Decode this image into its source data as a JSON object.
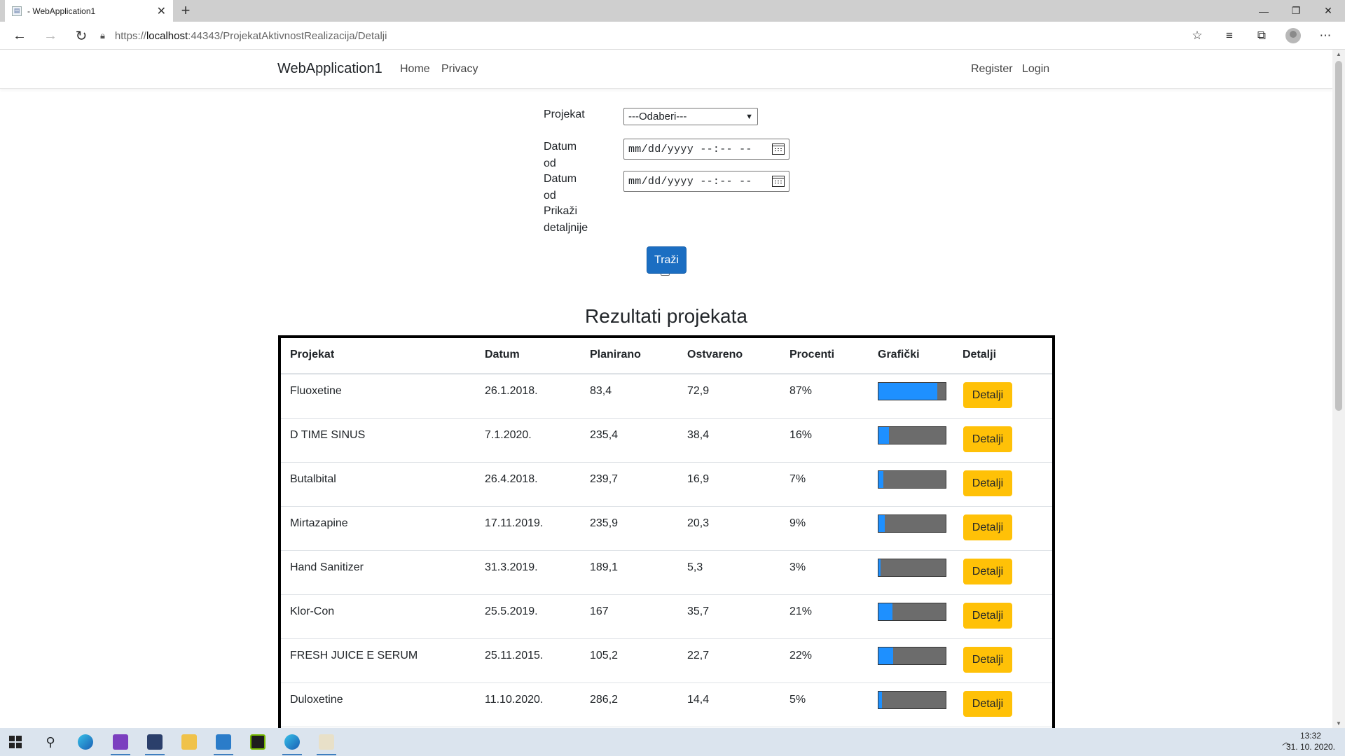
{
  "browser": {
    "tab_title": "- WebApplication1",
    "tab_close": "✕",
    "new_tab": "+",
    "url_prefix": "https://",
    "url_host": "localhost",
    "url_rest": ":44343/ProjekatAktivnostRealizacija/Detalji",
    "window_controls": [
      "—",
      "❐",
      "✕"
    ]
  },
  "navbar": {
    "brand": "WebApplication1",
    "links": [
      "Home",
      "Privacy"
    ],
    "right_links": [
      "Register",
      "Login"
    ]
  },
  "form": {
    "projekat_label": "Projekat",
    "projekat_selected": "---Odaberi---",
    "datum_od_label_1": "Datum od",
    "datum_od_value_1": "mm/dd/yyyy --:-- --",
    "datum_od_label_2": "Datum od",
    "datum_od_value_2": "mm/dd/yyyy --:-- --",
    "prikazi_label_line1": "Prikaži",
    "prikazi_label_line2": "detaljnije",
    "search_button": "Traži"
  },
  "results": {
    "heading": "Rezultati projekata",
    "columns": [
      "Projekat",
      "Datum",
      "Planirano",
      "Ostvareno",
      "Procenti",
      "Grafički",
      "Detalji"
    ],
    "details_button": "Detalji",
    "rows": [
      {
        "projekat": "Fluoxetine",
        "datum": "26.1.2018.",
        "planirano": "83,4",
        "ostvareno": "72,9",
        "procenti": "87%",
        "fraction": 0.87
      },
      {
        "projekat": "D TIME SINUS",
        "datum": "7.1.2020.",
        "planirano": "235,4",
        "ostvareno": "38,4",
        "procenti": "16%",
        "fraction": 0.16
      },
      {
        "projekat": "Butalbital",
        "datum": "26.4.2018.",
        "planirano": "239,7",
        "ostvareno": "16,9",
        "procenti": "7%",
        "fraction": 0.07
      },
      {
        "projekat": "Mirtazapine",
        "datum": "17.11.2019.",
        "planirano": "235,9",
        "ostvareno": "20,3",
        "procenti": "9%",
        "fraction": 0.09
      },
      {
        "projekat": "Hand Sanitizer",
        "datum": "31.3.2019.",
        "planirano": "189,1",
        "ostvareno": "5,3",
        "procenti": "3%",
        "fraction": 0.03
      },
      {
        "projekat": "Klor-Con",
        "datum": "25.5.2019.",
        "planirano": "167",
        "ostvareno": "35,7",
        "procenti": "21%",
        "fraction": 0.21
      },
      {
        "projekat": "FRESH JUICE E SERUM",
        "datum": "25.11.2015.",
        "planirano": "105,2",
        "ostvareno": "22,7",
        "procenti": "22%",
        "fraction": 0.22
      },
      {
        "projekat": "Duloxetine",
        "datum": "11.10.2020.",
        "planirano": "286,2",
        "ostvareno": "14,4",
        "procenti": "5%",
        "fraction": 0.05
      }
    ]
  },
  "taskbar": {
    "time": "13:32",
    "date": "31. 10. 2020."
  },
  "colors": {
    "primary_button": "#1b6ec2",
    "warning_button": "#ffc107",
    "bar_fill": "#1e90ff",
    "bar_track": "#6c6c6c"
  }
}
